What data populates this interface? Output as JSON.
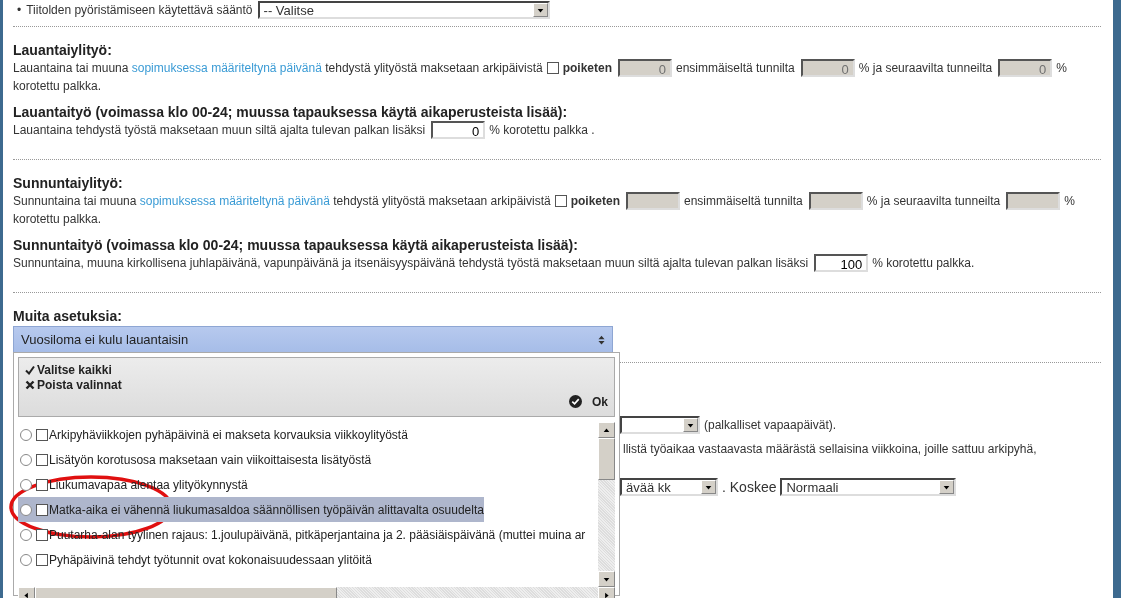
{
  "top_rule": {
    "bullet": "•",
    "label": "Tiitolden pyöristämiseen käytettävä sääntö",
    "select": "-- Valitse"
  },
  "groups": [
    {
      "sections": [
        {
          "kind": "overtime",
          "title": "Lauantaiylityö:",
          "text_before": "Lauantaina tai muuna ",
          "link": "sopimuksessa määriteltynä päivänä",
          "text_after": " tehdystä ylityöstä maksetaan arkipäivistä",
          "checkbox": {
            "checked": false,
            "label": "poiketen"
          },
          "inputs": [
            {
              "value": "0",
              "disabled": true,
              "after": "ensimmäiseltä tunnilta"
            },
            {
              "value": "0",
              "disabled": true,
              "after": "% ja seuraavilta tunneilta"
            },
            {
              "value": "0",
              "disabled": true,
              "after": "%"
            }
          ],
          "continuation": "korotettu palkka."
        },
        {
          "kind": "work",
          "title": "Lauantaityö (voimassa klo 00-24; muussa tapauksessa käytä aikaperusteista lisää):",
          "text": "Lauantaina tehdystä työstä maksetaan muun siltä ajalta tulevan palkan lisäksi",
          "input": {
            "value": "0",
            "disabled": false
          },
          "after": "% korotettu palkka ."
        }
      ]
    },
    {
      "sections": [
        {
          "kind": "overtime",
          "title": "Sunnuntaiylityö:",
          "text_before": "Sunnuntaina tai muuna ",
          "link": "sopimuksessa määriteltynä päivänä",
          "text_after": " tehdystä ylityöstä maksetaan arkipäivistä",
          "checkbox": {
            "checked": false,
            "label": "poiketen"
          },
          "inputs": [
            {
              "disabled": true,
              "after": "ensimmäiseltä tunnilta"
            },
            {
              "disabled": true,
              "after": "% ja seuraavilta tunneilta"
            },
            {
              "disabled": true,
              "after": "%"
            }
          ],
          "continuation": "korotettu palkka."
        },
        {
          "kind": "work",
          "title": "Sunnuntaityö (voimassa klo 00-24; muussa tapauksessa käytä aikaperusteista lisää):",
          "text": "Sunnuntaina, muuna kirkollisena juhlapäivänä, vapunpäivänä ja itsenäisyyspäivänä tehdystä työstä maksetaan muun siltä ajalta tulevan palkan lisäksi",
          "input": {
            "value": "100",
            "disabled": false
          },
          "after": "% korotettu palkka."
        }
      ]
    }
  ],
  "other_settings": {
    "title": "Muita asetuksia:",
    "select": "Vuosiloma ei kulu lauantaisin",
    "panel": {
      "select_all": "Valitse kaikki",
      "clear": "Poista valinnat",
      "ok": "Ok",
      "items": [
        {
          "label": "Arkipyhäviikkojen pyhäpäivinä ei makseta korvauksia viikkoylityöstä",
          "selected": false,
          "checked": false,
          "highlighted": false
        },
        {
          "label": "Lisätyön korotusosa maksetaan vain viikoittaisesta lisätyöstä",
          "selected": false,
          "checked": false,
          "highlighted": false
        },
        {
          "label": "Liukumavapaa alentaa ylityökynnystä",
          "selected": false,
          "checked": false,
          "highlighted": false
        },
        {
          "label": "Matka-aika ei vähennä liukumasaldoa säännöllisen työpäivän alittavalta osuudelta",
          "selected": false,
          "checked": false,
          "highlighted": true
        },
        {
          "label": "Puutarha-alan tyylinen rajaus: 1.joulupäivänä, pitkäperjantaina ja 2. pääsiäispäivänä (muttei muina ar",
          "selected": false,
          "checked": false,
          "highlighted": false
        },
        {
          "label": "Pyhäpäivinä tehdyt työtunnit ovat kokonaisuudessaan ylitöitä",
          "selected": false,
          "checked": false,
          "highlighted": false
        }
      ]
    },
    "behind": {
      "row1_after": "(palkalliset vapaapäivät).",
      "row2_text": "llistä työaikaa vastaavasta määrästä sellaisina viikkoina, joille sattuu arkipyhä,",
      "row3_select": "ävää kk",
      "row3_label": ". Koskee",
      "row3_select2": "Normaali"
    }
  }
}
